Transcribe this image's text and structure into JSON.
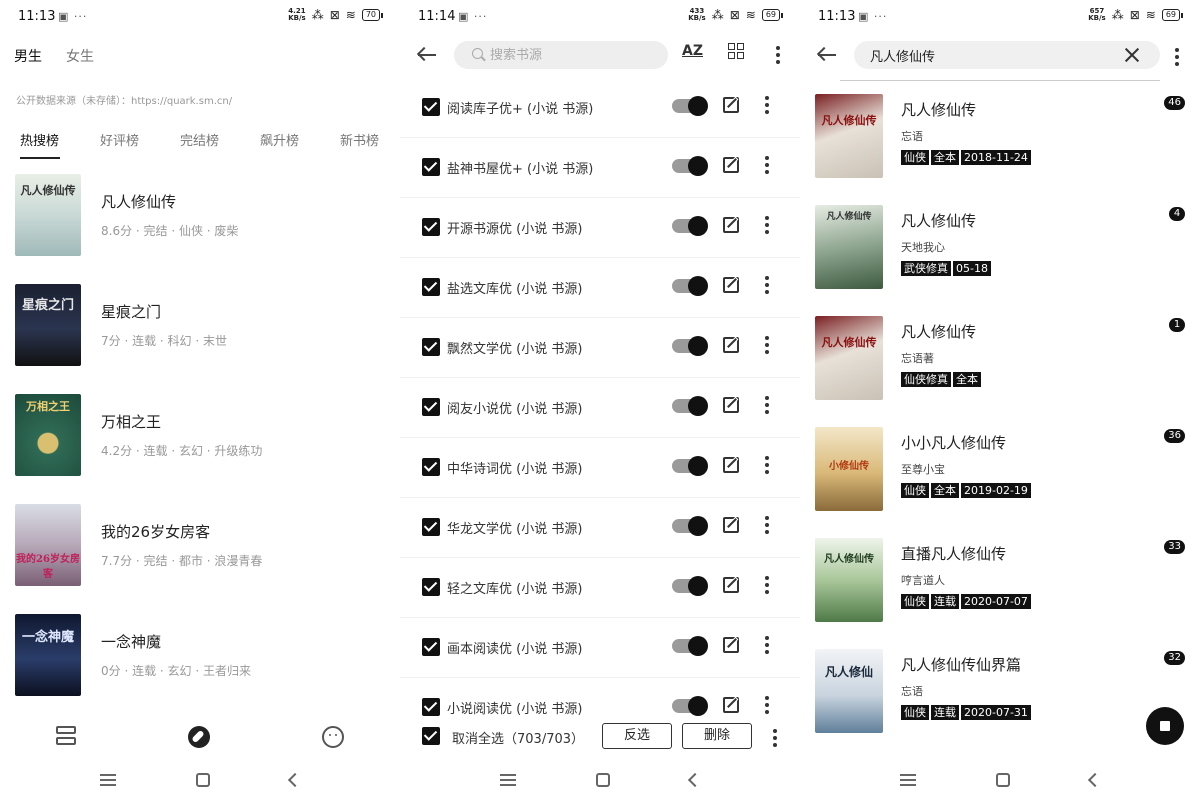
{
  "screen1": {
    "status": {
      "time": "11:13",
      "netspeed": "4.21\nKB/s",
      "battery": "70"
    },
    "gender_tabs": [
      "男生",
      "女生"
    ],
    "source_note": "公开数据来源（未存储）：https://quark.sm.cn/",
    "rank_tabs": [
      "热搜榜",
      "好评榜",
      "完结榜",
      "飙升榜",
      "新书榜"
    ],
    "books": [
      {
        "title": "凡人修仙传",
        "meta": "8.6分 · 完结 · 仙侠 · 废柴",
        "cover_text": "凡人修仙传"
      },
      {
        "title": "星痕之门",
        "meta": "7分 · 连载 · 科幻 · 末世",
        "cover_text": "星痕之门"
      },
      {
        "title": "万相之王",
        "meta": "4.2分 · 连载 · 玄幻 · 升级练功",
        "cover_text": "万相之王"
      },
      {
        "title": "我的26岁女房客",
        "meta": "7.7分 · 完结 · 都市 · 浪漫青春",
        "cover_text": "我的26岁女房客"
      },
      {
        "title": "一念神魔",
        "meta": "0分 · 连载 · 玄幻 · 王者归来",
        "cover_text": "一念神魔"
      }
    ]
  },
  "screen2": {
    "status": {
      "time": "11:14",
      "netspeed": "433\nKB/s",
      "battery": "69"
    },
    "search_placeholder": "搜索书源",
    "sort_label": "AZ",
    "sources": [
      "阅读库子优+ (小说 书源)",
      "盐神书屋优+ (小说 书源)",
      "开源书源优 (小说 书源)",
      "盐选文库优 (小说 书源)",
      "飘然文学优 (小说 书源)",
      "阅友小说优 (小说 书源)",
      "中华诗词优 (小说 书源)",
      "华龙文学优 (小说 书源)",
      "轻之文库优 (小说 书源)",
      "画本阅读优 (小说 书源)",
      "小说阅读优 (小说 书源)"
    ],
    "select_all_label": "取消全选（703/703）",
    "invert_label": "反选",
    "delete_label": "删除"
  },
  "screen3": {
    "status": {
      "time": "11:13",
      "netspeed": "657\nKB/s",
      "battery": "69"
    },
    "query": "凡人修仙传",
    "results": [
      {
        "title": "凡人修仙传",
        "author": "忘语",
        "tags": [
          "仙侠",
          "全本",
          "2018-11-24"
        ],
        "count": "46",
        "cover_text": "凡人修仙传"
      },
      {
        "title": "凡人修仙传",
        "author": "天地我心",
        "tags": [
          "武侠修真",
          "05-18"
        ],
        "count": "4",
        "cover_text": "凡人修仙传"
      },
      {
        "title": "凡人修仙传",
        "author": "忘语著",
        "tags": [
          "仙侠修真",
          "全本"
        ],
        "count": "1",
        "cover_text": "凡人修仙传"
      },
      {
        "title": "小小凡人修仙传",
        "author": "至尊小宝",
        "tags": [
          "仙侠",
          "全本",
          "2019-02-19"
        ],
        "count": "36",
        "cover_text": "小修仙传"
      },
      {
        "title": "直播凡人修仙传",
        "author": "哼言道人",
        "tags": [
          "仙侠",
          "连载",
          "2020-07-07"
        ],
        "count": "33",
        "cover_text": "凡人修仙传"
      },
      {
        "title": "凡人修仙传仙界篇",
        "author": "忘语",
        "tags": [
          "仙侠",
          "连载",
          "2020-07-31"
        ],
        "count": "32",
        "cover_text": "凡人修仙"
      }
    ]
  },
  "colors": {
    "accent": "#111111",
    "toggle_track": "#9a9a9a",
    "muted_text": "#999999"
  }
}
